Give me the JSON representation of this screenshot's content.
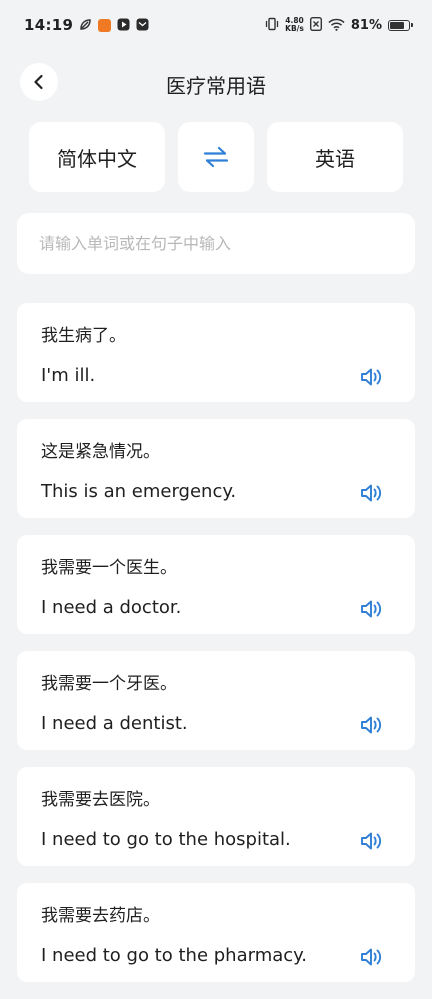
{
  "status_bar": {
    "time": "14:19",
    "net_speed_value": "4.80",
    "net_speed_unit": "KB/s",
    "battery_percent": "81%",
    "battery_level": 0.81
  },
  "header": {
    "title": "医疗常用语"
  },
  "language": {
    "source": "简体中文",
    "target": "英语"
  },
  "search": {
    "placeholder": "请输入单词或在句子中输入"
  },
  "colors": {
    "accent": "#2f7fd6",
    "background": "#f2f3f5",
    "card": "#ffffff"
  },
  "phrases": [
    {
      "zh": "我生病了。",
      "en": "I'm ill."
    },
    {
      "zh": "这是紧急情况。",
      "en": "This is an emergency."
    },
    {
      "zh": "我需要一个医生。",
      "en": "I need a doctor."
    },
    {
      "zh": "我需要一个牙医。",
      "en": "I need a dentist."
    },
    {
      "zh": "我需要去医院。",
      "en": "I need to go to the hospital."
    },
    {
      "zh": "我需要去药店。",
      "en": "I need to go to the pharmacy."
    }
  ]
}
